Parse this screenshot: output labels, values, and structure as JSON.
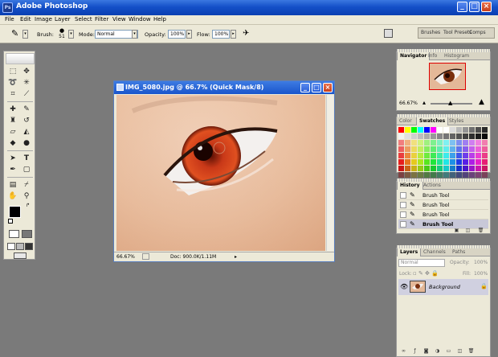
{
  "app": {
    "title": "Adobe Photoshop",
    "logo": "Ps"
  },
  "window_controls": {
    "minimize": "_",
    "maximize": "□",
    "close": "×"
  },
  "menu": [
    "File",
    "Edit",
    "Image",
    "Layer",
    "Select",
    "Filter",
    "View",
    "Window",
    "Help"
  ],
  "options": {
    "brush_label": "Brush:",
    "brush_size": "51",
    "mode_label": "Mode:",
    "mode_value": "Normal",
    "opacity_label": "Opacity:",
    "opacity_value": "100%",
    "flow_label": "Flow:",
    "flow_value": "100%"
  },
  "palette_well": {
    "tabs": [
      "Brushes",
      "Tool Presets",
      "Comps"
    ]
  },
  "document": {
    "title": "IMG_5080.jpg @ 66.7% (Quick Mask/8)",
    "zoom": "66.67%",
    "doc_size": "Doc: 900.0K/1.11M"
  },
  "navigator": {
    "tabs": [
      "Navigator",
      "Info",
      "Histogram"
    ],
    "zoom": "66.67%"
  },
  "color_panel": {
    "tabs": [
      "Color",
      "Swatches",
      "Styles"
    ]
  },
  "history": {
    "tabs": [
      "History",
      "Actions"
    ],
    "items": [
      "Brush Tool",
      "Brush Tool",
      "Brush Tool",
      "Brush Tool"
    ],
    "selected_index": 3
  },
  "layers": {
    "tabs": [
      "Layers",
      "Channels",
      "Paths"
    ],
    "blend_mode": "Normal",
    "opacity_label": "Opacity:",
    "opacity_value": "100%",
    "lock_label": "Lock:",
    "fill_label": "Fill:",
    "fill_value": "100%",
    "layer_name": "Background"
  },
  "colors": {
    "title_bar": "#1450c8",
    "chrome": "#ece9d8",
    "workspace": "#7a7a7a",
    "iris": "#c83818",
    "skin": "#e8bc9c"
  },
  "icons": [
    "photoshop-logo",
    "brush-icon",
    "airbrush-icon",
    "eye-icon",
    "lock-icon",
    "trash-icon",
    "new-layer-icon"
  ]
}
